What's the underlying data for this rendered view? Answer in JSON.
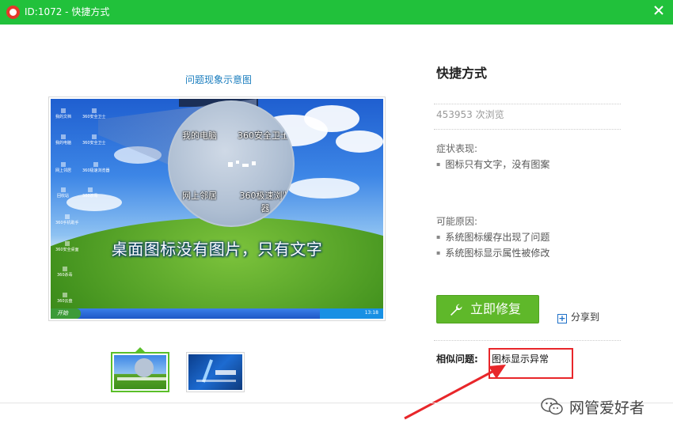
{
  "window": {
    "title": "ID:1072 - 快捷方式",
    "accent": "#21c13b"
  },
  "preview": {
    "caption": "问题现象示意图",
    "overlay_text": "桌面图标没有图片，只有文字",
    "magnifier_labels": [
      "我的电脑",
      "360安全卫士",
      "网上邻居",
      "360极速浏览器"
    ],
    "taskbar_start": "开始",
    "taskbar_time": "13:18"
  },
  "thumbnails": [
    {
      "label": "示意图1",
      "active": true
    },
    {
      "label": "示意图2",
      "active": false
    }
  ],
  "solution": {
    "title": "快捷方式",
    "views": "453953 次浏览",
    "symptom_label": "症状表现:",
    "symptoms": [
      "图标只有文字，没有图案"
    ],
    "cause_label": "可能原因:",
    "causes": [
      "系统图标缓存出现了问题",
      "系统图标显示属性被修改"
    ],
    "fix_button": "立即修复",
    "share_label": "分享到",
    "similar_label": "相似问题:",
    "similar_items": [
      "图标显示异常"
    ]
  },
  "annotation": {
    "color": "#e8262a"
  },
  "watermark": {
    "text": "网管爱好者",
    "icon": "wechat-icon"
  }
}
